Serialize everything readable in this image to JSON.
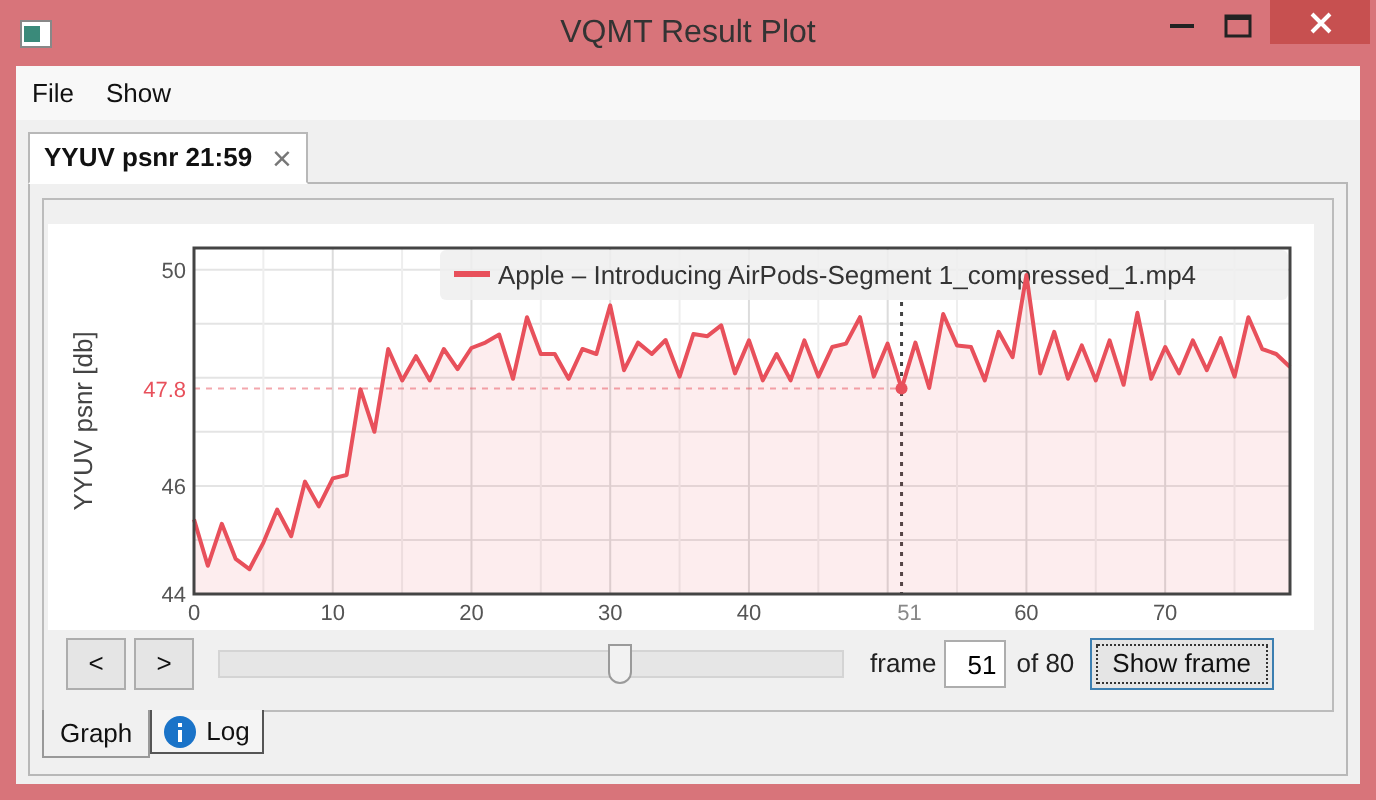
{
  "window": {
    "title": "VQMT Result Plot"
  },
  "menu": [
    {
      "label": "File"
    },
    {
      "label": "Show"
    }
  ],
  "tabs": [
    {
      "label": "YYUV psnr 21:59",
      "close": "×",
      "selected": true
    }
  ],
  "plot": {
    "chart_data": {
      "type": "area",
      "ylabel": "YYUV psnr [db]",
      "xlim": [
        0,
        79
      ],
      "ylim": [
        44,
        50.4
      ],
      "grid": true,
      "x": [
        0,
        1,
        2,
        3,
        4,
        5,
        6,
        7,
        8,
        9,
        10,
        11,
        12,
        13,
        14,
        15,
        16,
        17,
        18,
        19,
        20,
        21,
        22,
        23,
        24,
        25,
        26,
        27,
        28,
        29,
        30,
        31,
        32,
        33,
        34,
        35,
        36,
        37,
        38,
        39,
        40,
        41,
        42,
        43,
        44,
        45,
        46,
        47,
        48,
        49,
        50,
        51,
        52,
        53,
        54,
        55,
        56,
        57,
        58,
        59,
        60,
        61,
        62,
        63,
        64,
        65,
        66,
        67,
        68,
        69,
        70,
        71,
        72,
        73,
        74,
        75,
        76,
        77,
        78,
        79
      ],
      "xticks": [
        0,
        10,
        20,
        30,
        40,
        {
          "value": 51,
          "label": "51"
        },
        60,
        70
      ],
      "yticks": [
        44,
        46,
        {
          "value": 47.8,
          "label": "47.8"
        },
        50
      ],
      "series": [
        {
          "name": "Apple – Introducing AirPods-Segment 1_compressed_1.mp4",
          "color": "#e8505b",
          "values": [
            45.38,
            44.52,
            45.3,
            44.65,
            44.46,
            44.95,
            45.56,
            45.07,
            46.08,
            45.62,
            46.14,
            46.2,
            47.79,
            47.0,
            48.53,
            47.95,
            48.4,
            47.95,
            48.53,
            48.16,
            48.55,
            48.65,
            48.8,
            47.98,
            49.12,
            48.44,
            48.44,
            47.98,
            48.53,
            48.44,
            49.34,
            48.14,
            48.65,
            48.44,
            48.7,
            48.02,
            48.81,
            48.77,
            48.97,
            48.08,
            48.69,
            47.95,
            48.44,
            47.95,
            48.69,
            48.02,
            48.57,
            48.63,
            49.12,
            48.02,
            48.63,
            47.8,
            48.65,
            47.81,
            49.18,
            48.6,
            48.57,
            47.95,
            48.85,
            48.38,
            49.9,
            48.08,
            48.85,
            47.98,
            48.6,
            47.95,
            48.69,
            47.87,
            49.2,
            47.98,
            48.57,
            48.08,
            48.69,
            48.14,
            48.73,
            48.02,
            49.12,
            48.53,
            48.44,
            48.2
          ]
        }
      ],
      "ref_lines": [
        {
          "axis": "x",
          "value": 51
        },
        {
          "axis": "y",
          "value": 47.8
        }
      ]
    }
  },
  "controls": {
    "prev": "<",
    "next": ">",
    "slider": {
      "level": 0.64
    },
    "frame_label": "frame",
    "frame_value": "51",
    "of_label": "of 80",
    "show_button": {
      "label": "Show frame",
      "focused": true
    }
  },
  "bottom_tabs": [
    {
      "label": "Graph",
      "selected": true,
      "icon": false
    },
    {
      "label": "Log",
      "selected": false,
      "icon": true
    }
  ]
}
